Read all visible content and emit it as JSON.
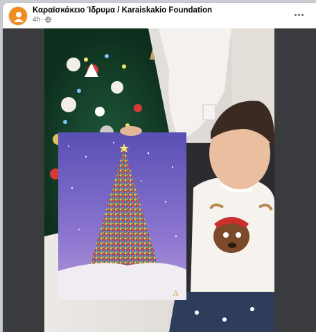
{
  "post": {
    "page_name": "Καραϊσκάκειο Ίδρυμα / Karaiskakio Foundation",
    "timestamp": "4h",
    "audience_icon": "globe-icon",
    "more_icon": "more-options-icon"
  },
  "photo": {
    "signature": "A"
  },
  "colors": {
    "avatar": "#f18c1f",
    "canvas_sky": "#7b6bc7",
    "frame": "#3a3b3e"
  }
}
